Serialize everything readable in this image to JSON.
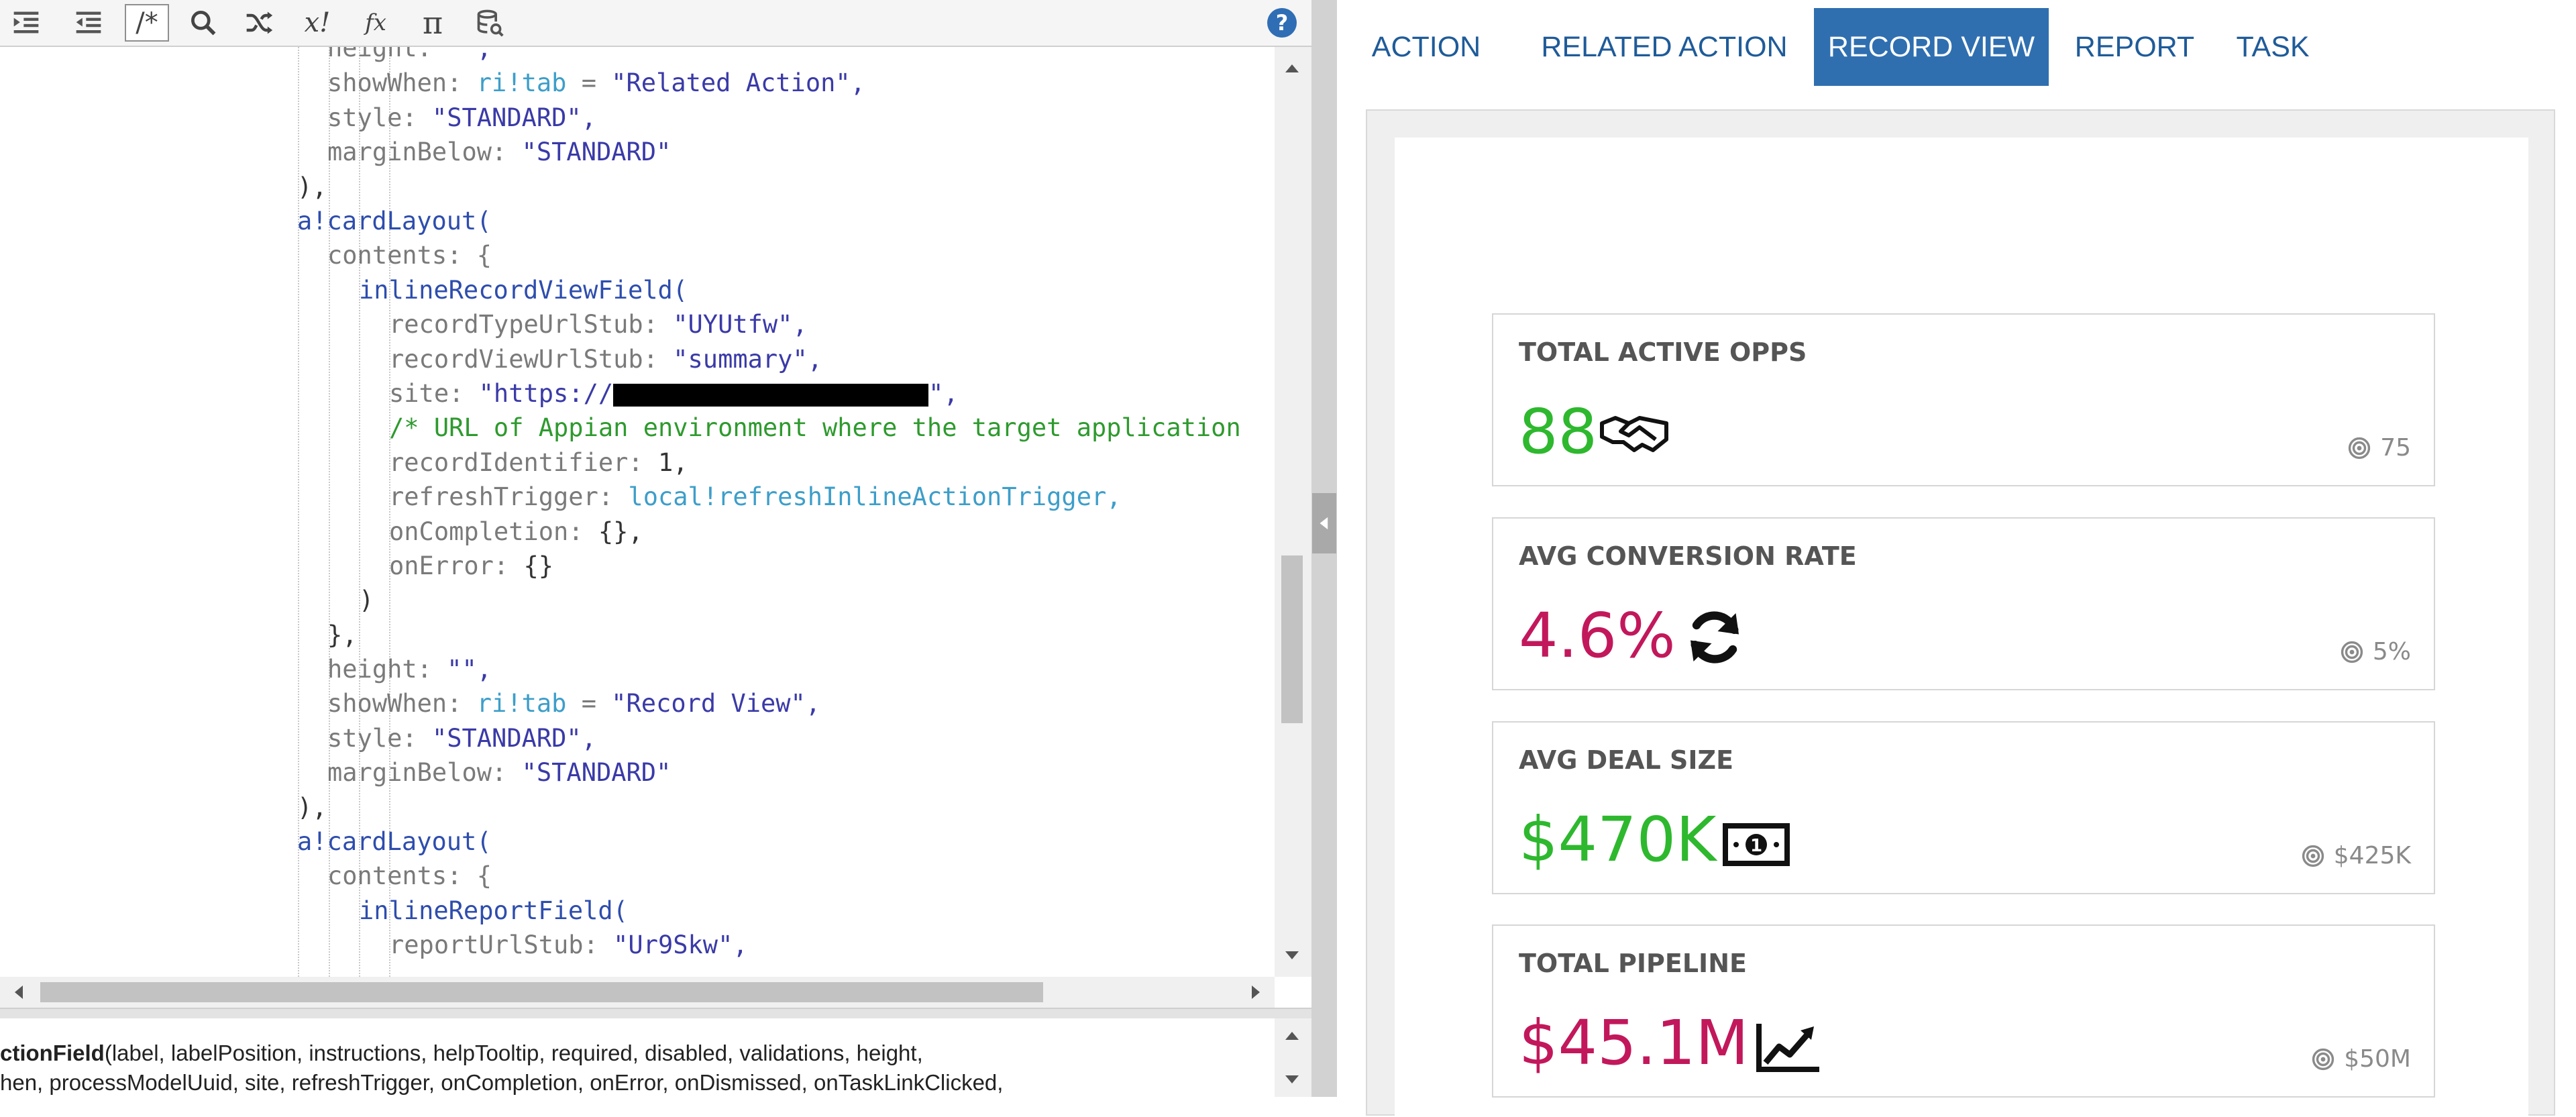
{
  "editor": {
    "toolbar": {
      "indent_icon": "indent-icon",
      "outdent_icon": "outdent-icon",
      "comment_label": "/*",
      "search_icon": "search-icon",
      "shuffle_icon": "shuffle-icon",
      "factorial_label": "x!",
      "function_label": "f𝑥",
      "pi_label": "π",
      "database_icon": "database-icon",
      "help_label": "?"
    },
    "code": {
      "l0_key": "height: ",
      "l0_val": "\"\",",
      "l1_key": "showWhen: ",
      "l1_ref": "ri!tab",
      "l1_op": " = ",
      "l1_val": "\"Related Action\",",
      "l2_key": "style: ",
      "l2_val": "\"STANDARD\",",
      "l3_key": "marginBelow: ",
      "l3_val": "\"STANDARD\"",
      "l4": "),",
      "l5": "a!cardLayout(",
      "l6": "contents: {",
      "l7": "inlineRecordViewField(",
      "l8_key": "recordTypeUrlStub: ",
      "l8_val": "\"UYUtfw\",",
      "l9_key": "recordViewUrlStub: ",
      "l9_val": "\"summary\",",
      "l10_key": "site: ",
      "l10_val_pre": "\"https://",
      "l10_val_post": "\",",
      "l11": "/* URL of Appian environment where the target application",
      "l12_key": "recordIdentifier: ",
      "l12_val": "1,",
      "l13_key": "refreshTrigger: ",
      "l13_val": "local!refreshInlineActionTrigger,",
      "l14_key": "onCompletion: ",
      "l14_val": "{},",
      "l15_key": "onError: ",
      "l15_val": "{}",
      "l16": ")",
      "l17": "},",
      "l18_key": "height: ",
      "l18_val": "\"\",",
      "l19_key": "showWhen: ",
      "l19_ref": "ri!tab",
      "l19_op": " = ",
      "l19_val": "\"Record View\",",
      "l20_key": "style: ",
      "l20_val": "\"STANDARD\",",
      "l21_key": "marginBelow: ",
      "l21_val": "\"STANDARD\"",
      "l22": "),",
      "l23": "a!cardLayout(",
      "l24": "contents: {",
      "l25": "inlineReportField(",
      "l26_key": "reportUrlStub: ",
      "l26_val": "\"Ur9Skw\","
    },
    "signature": {
      "bold": "ctionField",
      "line1_rest": "(label, labelPosition, instructions, helpTooltip, required, disabled, validations, height,",
      "line2": "hen, processModelUuid, site, refreshTrigger, onCompletion, onError, onDismissed, onTaskLinkClicked,"
    }
  },
  "preview": {
    "tabs": [
      "ACTION",
      "RELATED ACTION",
      "RECORD VIEW",
      "REPORT",
      "TASK"
    ],
    "selected_tab": "RECORD VIEW",
    "cards": [
      {
        "title": "TOTAL ACTIVE OPPS",
        "value": "88",
        "icon": "handshake-icon",
        "target": "75",
        "color": "#2eb82e"
      },
      {
        "title": "AVG CONVERSION RATE",
        "value": "4.6%",
        "icon": "refresh-icon",
        "target": "5%",
        "color": "#c2185b"
      },
      {
        "title": "AVG DEAL SIZE",
        "value": "$470K",
        "icon": "money-icon",
        "target": "$425K",
        "color": "#2eb82e"
      },
      {
        "title": "TOTAL PIPELINE",
        "value": "$45.1M",
        "icon": "trend-chart-icon",
        "target": "$50M",
        "color": "#c2185b"
      }
    ],
    "colors": {
      "accent": "#2f6fb0",
      "positive": "#2eb82e",
      "negative": "#c2185b"
    }
  }
}
